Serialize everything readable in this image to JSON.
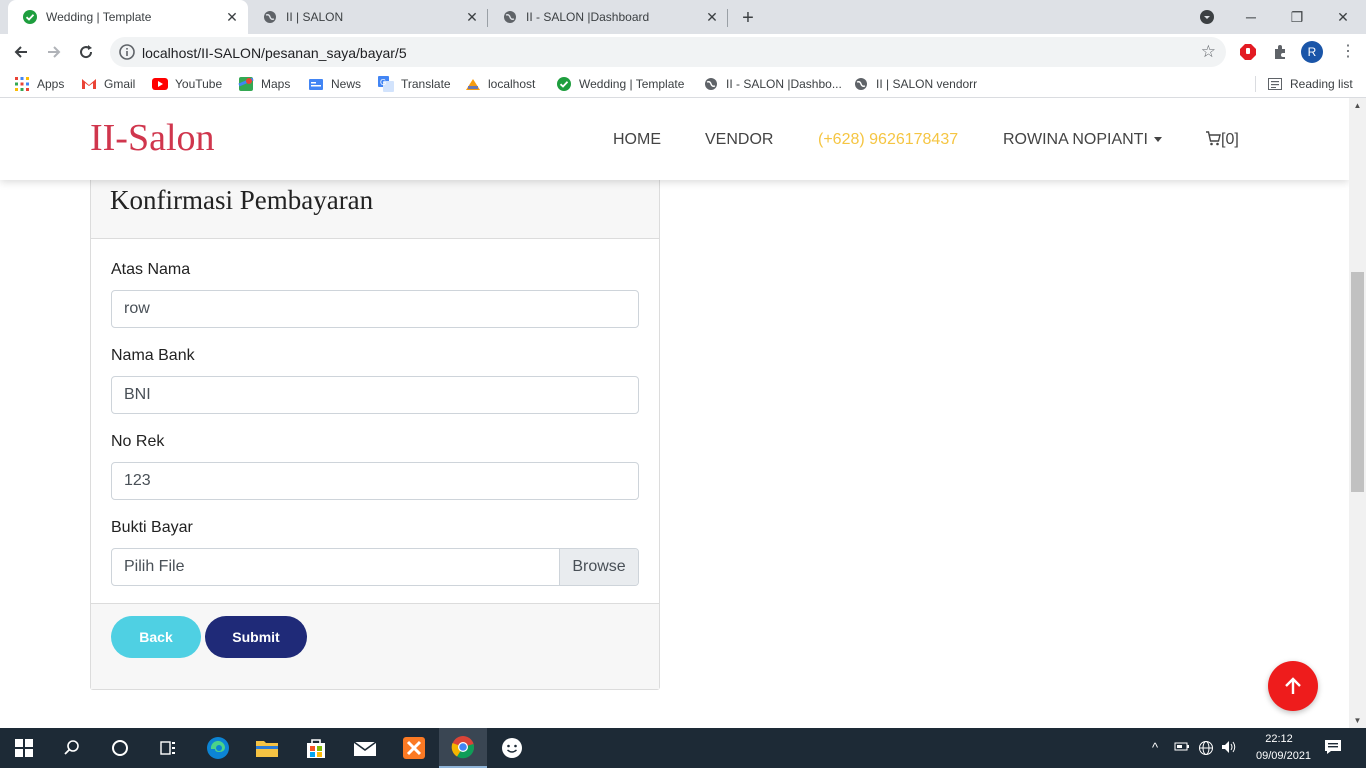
{
  "browser": {
    "tabs": [
      {
        "title": "Wedding | Template",
        "active": true
      },
      {
        "title": "II | SALON",
        "active": false
      },
      {
        "title": "II - SALON |Dashboard",
        "active": false
      }
    ],
    "url": "localhost/II-SALON/pesanan_saya/bayar/5",
    "profile_initial": "R",
    "bookmarks": [
      {
        "label": "Apps",
        "icon": "apps-grid-icon"
      },
      {
        "label": "Gmail",
        "icon": "gmail-icon"
      },
      {
        "label": "YouTube",
        "icon": "youtube-icon"
      },
      {
        "label": "Maps",
        "icon": "maps-icon"
      },
      {
        "label": "News",
        "icon": "news-icon"
      },
      {
        "label": "Translate",
        "icon": "translate-icon"
      },
      {
        "label": "localhost",
        "icon": "phpmyadmin-icon"
      },
      {
        "label": "Wedding | Template",
        "icon": "check-circle-icon"
      },
      {
        "label": "II - SALON |Dashbo...",
        "icon": "globe-icon"
      },
      {
        "label": "II | SALON vendorr",
        "icon": "globe-icon"
      }
    ],
    "reading_list": "Reading list"
  },
  "site": {
    "brand": "II-Salon",
    "nav": {
      "home": "HOME",
      "vendor": "VENDOR",
      "phone": "(+628) 9626178437",
      "user": "ROWINA NOPIANTI",
      "cart": "[0]"
    },
    "colors": {
      "brand": "#d0364d",
      "phone": "#f5c542",
      "back": "#4fd0e3",
      "submit": "#1f2a78",
      "to_top": "#ee1c1c"
    }
  },
  "form": {
    "title": "Konfirmasi Pembayaran",
    "atas_nama_label": "Atas Nama",
    "atas_nama_value": "row",
    "nama_bank_label": "Nama Bank",
    "nama_bank_value": "BNI",
    "no_rek_label": "No Rek",
    "no_rek_value": "123",
    "bukti_label": "Bukti Bayar",
    "bukti_placeholder": "Pilih File",
    "browse_label": "Browse",
    "back_label": "Back",
    "submit_label": "Submit"
  },
  "taskbar": {
    "time": "22:12",
    "date": "09/09/2021"
  }
}
